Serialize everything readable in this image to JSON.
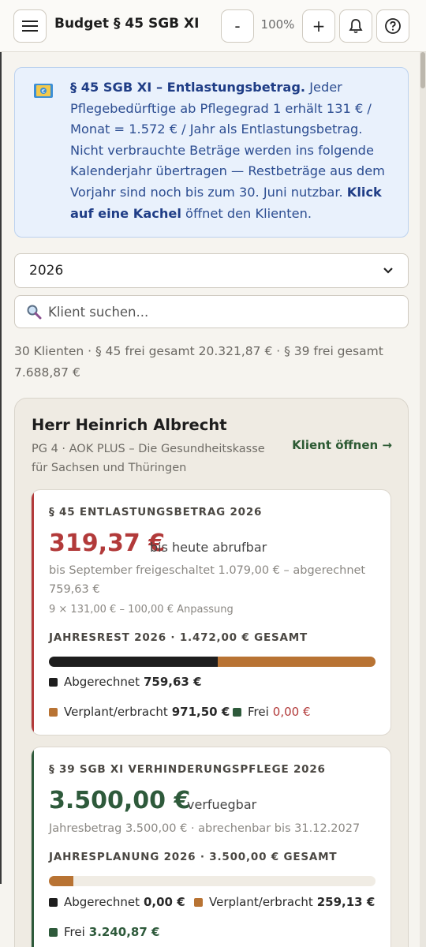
{
  "header": {
    "title": "Budget § 45 SGB XI",
    "zoom_out_label": "-",
    "zoom_level": "100%",
    "zoom_in_label": "+"
  },
  "info": {
    "strong_title": "§ 45 SGB XI – Entlastungsbetrag.",
    "text": " Jeder Pflegebedürftige ab Pflegegrad 1 erhält 131 € / Monat = 1.572 € / Jahr als Entlastungsbetrag. Nicht verbrauchte Beträge werden ins folgende Kalenderjahr übertragen — Restbeträge aus dem Vorjahr sind noch bis zum 30. Juni nutzbar. ",
    "strong_hint": "Klick auf eine Kachel",
    "hint_tail": " öffnet den Klienten."
  },
  "filters": {
    "year_selected": "2026",
    "search_placeholder": "Klient suchen..."
  },
  "summary": "30 Klienten · § 45 frei gesamt 20.321,87 € · § 39 frei gesamt 7.688,87 €",
  "client": {
    "name": "Herr Heinrich Albrecht",
    "meta": "PG 4 · AOK PLUS – Die Gesundheitskasse für Sachsen und Thüringen",
    "open_label": "Klient öffnen →",
    "entlastung": {
      "title": "§ 45 ENTLASTUNGSBETRAG 2026",
      "amount": "319,37 €",
      "amount_suffix": "bis heute abrufbar",
      "detail": "bis September freigeschaltet 1.079,00 € – abgerechnet 759,63 €",
      "formula": "9 × 131,00 € – 100,00 € Anpassung",
      "year_label": "JAHRESREST 2026 · 1.472,00 € GESAMT",
      "bar": {
        "abgerechnet_fraction": 0.516,
        "verplant_fraction": 0.484
      },
      "legend_abgerechnet_label": "Abgerechnet",
      "legend_abgerechnet_value": "759,63 €",
      "legend_verplant_label": "Verplant/erbracht",
      "legend_verplant_value": "971,50 €",
      "legend_frei_label": "Frei",
      "legend_frei_value": "0,00 €"
    },
    "verhinderung": {
      "title": "§ 39 SGB XI VERHINDERUNGSPFLEGE 2026",
      "amount": "3.500,00 €",
      "amount_suffix": "verfuegbar",
      "detail": "Jahresbetrag 3.500,00 € · abrechenbar bis 31.12.2027",
      "year_label": "JAHRESPLANUNG 2026 · 3.500,00 € GESAMT",
      "bar": {
        "abgerechnet_fraction": 0.0,
        "verplant_fraction": 0.074
      },
      "legend_abgerechnet_label": "Abgerechnet",
      "legend_abgerechnet_value": "0,00 €",
      "legend_verplant_label": "Verplant/erbracht",
      "legend_verplant_value": "259,13 €",
      "legend_frei_label": "Frei",
      "legend_frei_value": "3.240,87 €"
    }
  },
  "colors": {
    "abgerechnet": "#1e1e1e",
    "verplant": "#b87333",
    "frei": "#2e5a3b",
    "red_accent": "#b23a3a",
    "green_accent": "#2e5a3b"
  },
  "icons": {
    "menu": "menu-icon",
    "bell": "bell-icon",
    "help": "help-icon",
    "money": "money-icon",
    "search": "search-icon",
    "select": "chevron-down-icon"
  }
}
